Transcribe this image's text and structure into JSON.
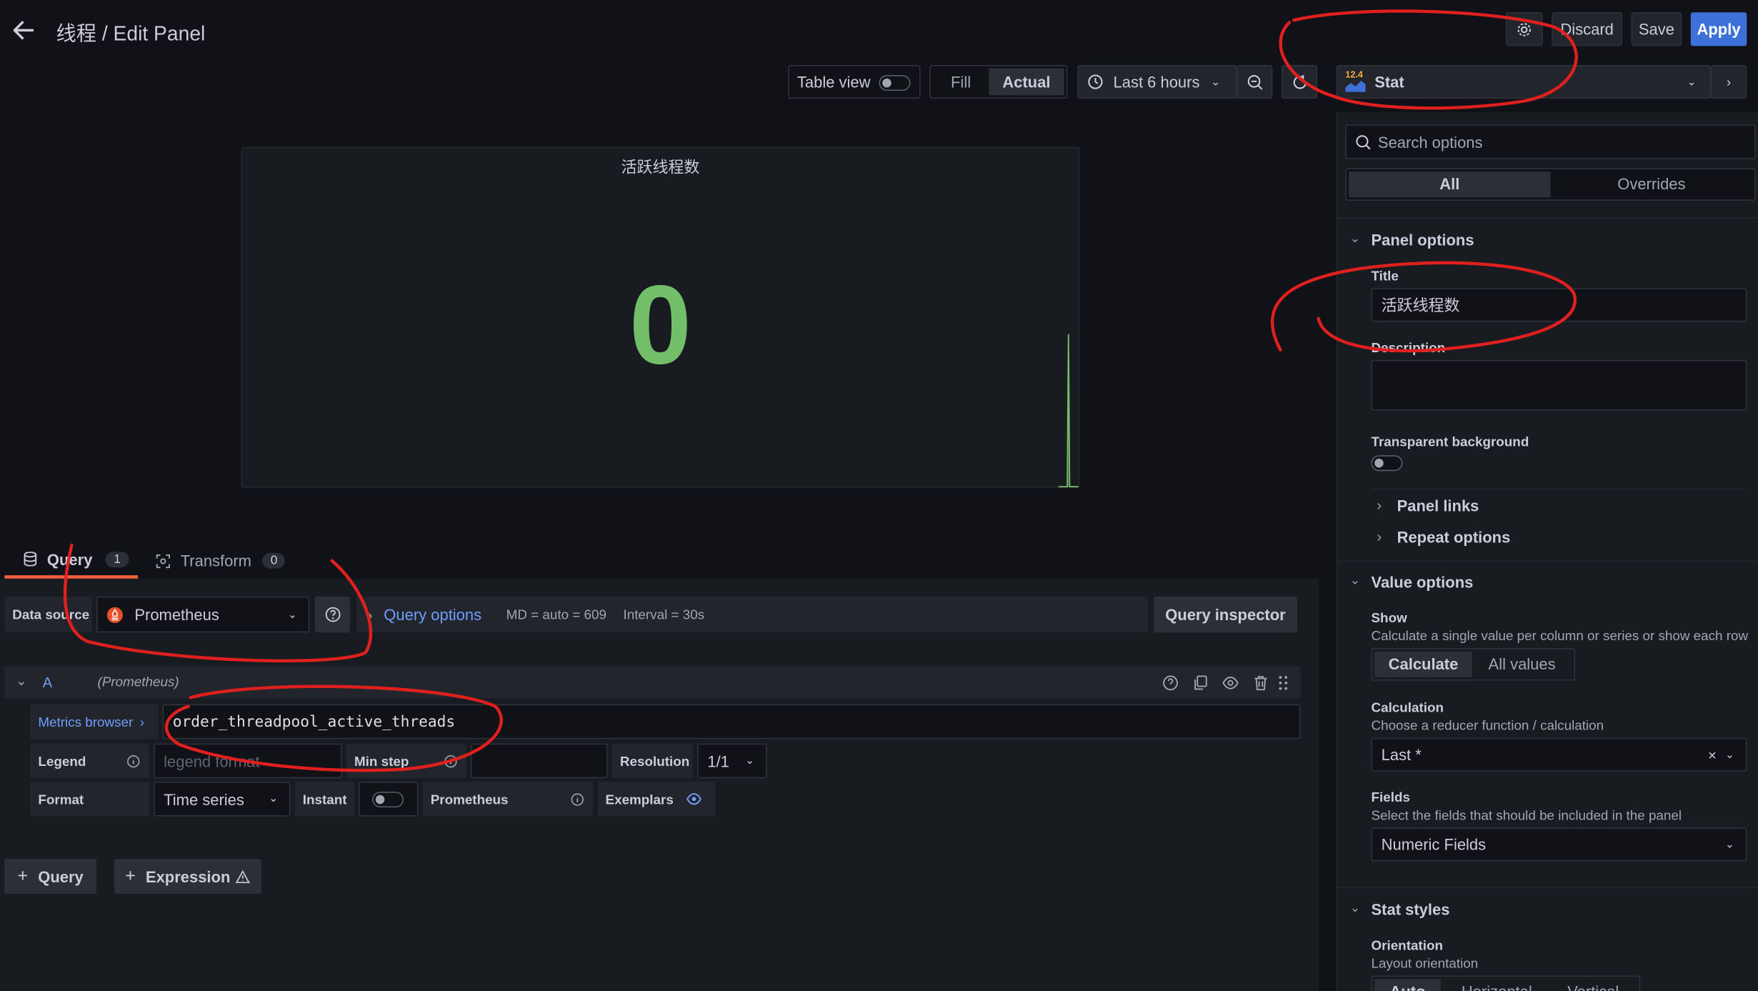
{
  "header": {
    "breadcrumb": "线程 / Edit Panel",
    "discard_label": "Discard",
    "save_label": "Save",
    "apply_label": "Apply"
  },
  "toolbar": {
    "table_view_label": "Table view",
    "fill_label": "Fill",
    "actual_label": "Actual",
    "time_range": "Last 6 hours",
    "viz_picker_value": "Stat",
    "viz_icon_text": "12.4"
  },
  "panel": {
    "title": "活跃线程数",
    "stat_value": "0",
    "stat_color": "#73bf69"
  },
  "query_tabs": {
    "query_label": "Query",
    "query_count": "1",
    "transform_label": "Transform",
    "transform_count": "0"
  },
  "datasource": {
    "label": "Data source",
    "value": "Prometheus",
    "query_options_label": "Query options",
    "md_info": "MD = auto = 609",
    "interval_info": "Interval = 30s",
    "inspector_label": "Query inspector"
  },
  "query_row": {
    "ref_id": "A",
    "ds_name": "(Prometheus)",
    "metrics_browser_label": "Metrics browser",
    "expr": "order_threadpool_active_threads",
    "legend_label": "Legend",
    "legend_placeholder": "legend format",
    "min_step_label": "Min step",
    "resolution_label": "Resolution",
    "resolution_value": "1/1",
    "format_label": "Format",
    "format_value": "Time series",
    "instant_label": "Instant",
    "type_label": "Prometheus",
    "exemplars_label": "Exemplars"
  },
  "add_buttons": {
    "query_label": "Query",
    "expression_label": "Expression"
  },
  "options_pane": {
    "search_placeholder": "Search options",
    "tab_all": "All",
    "tab_overrides": "Overrides",
    "panel_options_title": "Panel options",
    "title_label": "Title",
    "title_value": "活跃线程数",
    "description_label": "Description",
    "transparent_label": "Transparent background",
    "panel_links_label": "Panel links",
    "repeat_options_label": "Repeat options",
    "value_options_title": "Value options",
    "show_label": "Show",
    "show_desc": "Calculate a single value per column or series or show each row",
    "calculate_label": "Calculate",
    "all_values_label": "All values",
    "calculation_label": "Calculation",
    "calculation_desc": "Choose a reducer function / calculation",
    "calculation_value": "Last *",
    "fields_label": "Fields",
    "fields_desc": "Select the fields that should be included in the panel",
    "fields_value": "Numeric Fields",
    "stat_styles_title": "Stat styles",
    "orientation_label": "Orientation",
    "orientation_desc": "Layout orientation",
    "orientation_auto": "Auto",
    "orientation_horizontal": "Horizontal",
    "orientation_vertical": "Vertical"
  },
  "colors": {
    "accent_blue": "#3d71d9",
    "link_blue": "#6e9fff",
    "tab_underline": "#f55f3e",
    "annotation_red": "#e0201f"
  }
}
